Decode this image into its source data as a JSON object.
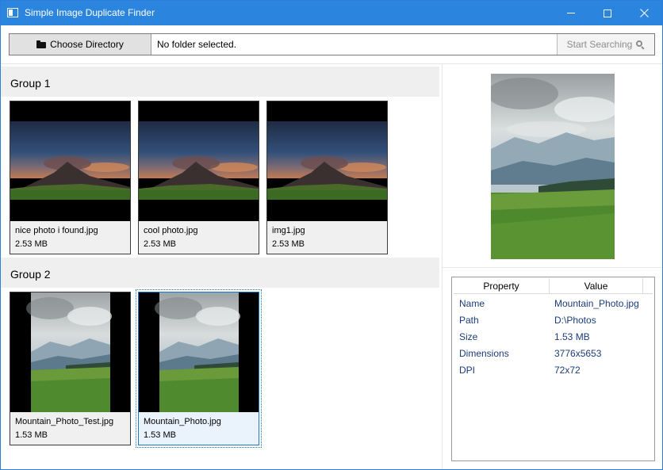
{
  "window": {
    "title": "Simple Image Duplicate Finder"
  },
  "toolbar": {
    "choose_label": "Choose Directory",
    "path_text": "No folder selected.",
    "search_label": "Start Searching"
  },
  "groups": [
    {
      "title": "Group 1",
      "items": [
        {
          "name": "nice photo i found.jpg",
          "size": "2.53 MB",
          "thumb": "mountain-night"
        },
        {
          "name": "cool photo.jpg",
          "size": "2.53 MB",
          "thumb": "mountain-night"
        },
        {
          "name": "img1.jpg",
          "size": "2.53 MB",
          "thumb": "mountain-night"
        }
      ]
    },
    {
      "title": "Group 2",
      "items": [
        {
          "name": "Mountain_Photo_Test.jpg",
          "size": "1.53 MB",
          "thumb": "mountain-day"
        },
        {
          "name": "Mountain_Photo.jpg",
          "size": "1.53 MB",
          "thumb": "mountain-day",
          "selected": true
        }
      ]
    }
  ],
  "properties": {
    "header_property": "Property",
    "header_value": "Value",
    "rows": [
      {
        "key": "Name",
        "value": "Mountain_Photo.jpg"
      },
      {
        "key": "Path",
        "value": "D:\\Photos"
      },
      {
        "key": "Size",
        "value": "1.53 MB"
      },
      {
        "key": "Dimensions",
        "value": "3776x5653"
      },
      {
        "key": "DPI",
        "value": "72x72"
      }
    ]
  },
  "colors": {
    "titlebar": "#2b84dd",
    "group_header": "#efefef",
    "selection": "#2277c4",
    "property_text": "#1a3c7a"
  },
  "icons": {
    "app": "app-window-icon",
    "choose": "folder-icon",
    "search": "search-icon",
    "minimize": "minimize-icon",
    "maximize": "maximize-icon",
    "close": "close-icon"
  }
}
